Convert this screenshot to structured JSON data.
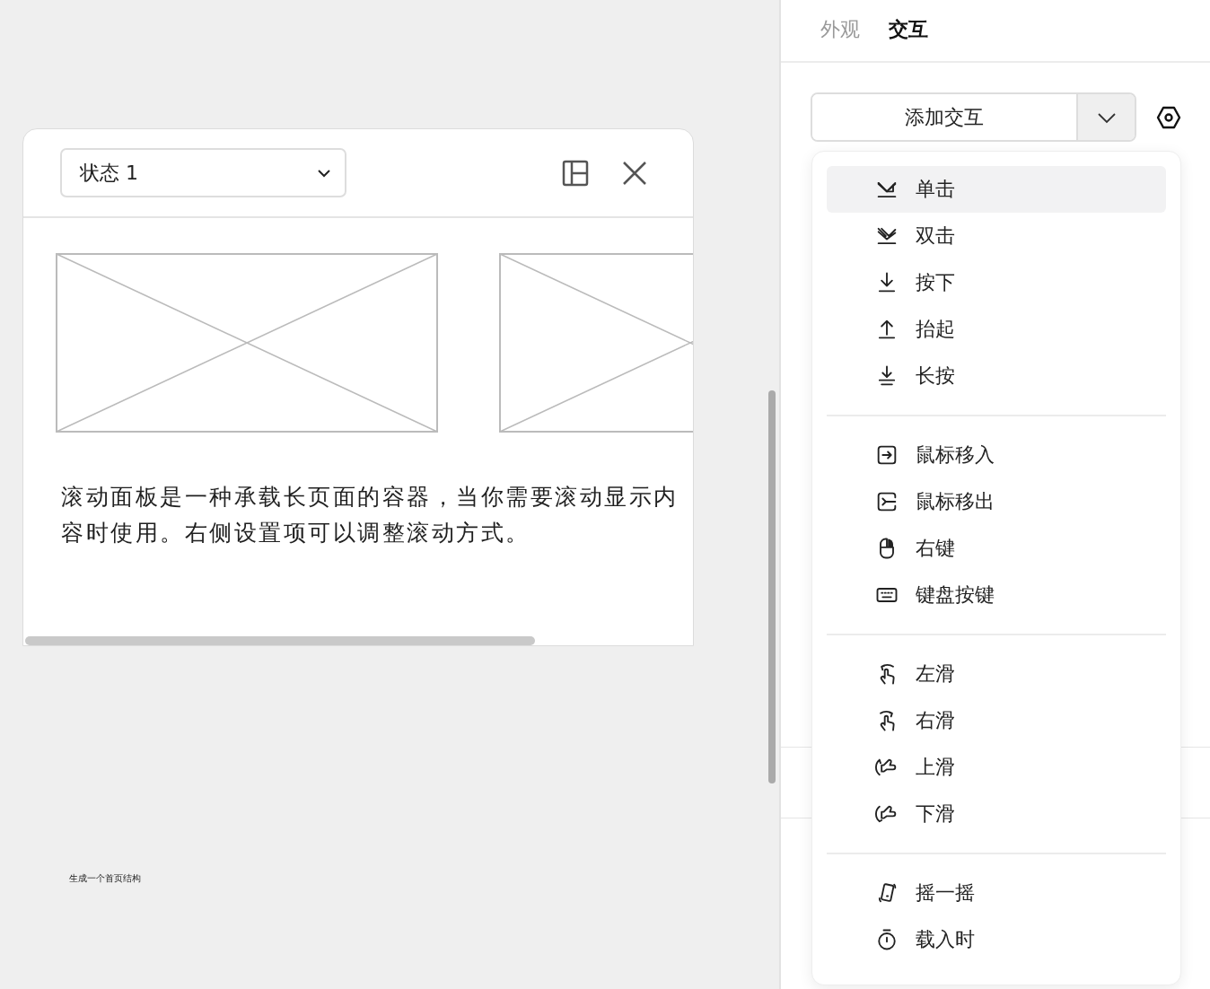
{
  "canvas": {
    "card": {
      "state_select": {
        "value": "状态 1"
      },
      "description": "滚动面板是一种承载长页面的容器，当你需要滚动显示内容时使用。右侧设置项可以调整滚动方式。"
    },
    "caption": "生成一个首页结构"
  },
  "panel": {
    "tabs": [
      {
        "label": "外观",
        "selected": false
      },
      {
        "label": "交互",
        "selected": true
      }
    ],
    "add_button": {
      "label": "添加交互"
    },
    "menu": {
      "groups": [
        {
          "items": [
            {
              "label": "单击",
              "kind": "click",
              "selected": true
            },
            {
              "label": "双击",
              "kind": "double-click",
              "selected": false
            },
            {
              "label": "按下",
              "kind": "press",
              "selected": false
            },
            {
              "label": "抬起",
              "kind": "release",
              "selected": false
            },
            {
              "label": "长按",
              "kind": "long-press",
              "selected": false
            }
          ]
        },
        {
          "items": [
            {
              "label": "鼠标移入",
              "kind": "mouse-enter",
              "selected": false
            },
            {
              "label": "鼠标移出",
              "kind": "mouse-leave",
              "selected": false
            },
            {
              "label": "右键",
              "kind": "right-click",
              "selected": false
            },
            {
              "label": "键盘按键",
              "kind": "keyboard",
              "selected": false
            }
          ]
        },
        {
          "items": [
            {
              "label": "左滑",
              "kind": "swipe-left",
              "selected": false
            },
            {
              "label": "右滑",
              "kind": "swipe-right",
              "selected": false
            },
            {
              "label": "上滑",
              "kind": "swipe-up",
              "selected": false
            },
            {
              "label": "下滑",
              "kind": "swipe-down",
              "selected": false
            }
          ]
        },
        {
          "items": [
            {
              "label": "摇一摇",
              "kind": "shake",
              "selected": false
            },
            {
              "label": "载入时",
              "kind": "load",
              "selected": false
            }
          ]
        }
      ]
    }
  }
}
